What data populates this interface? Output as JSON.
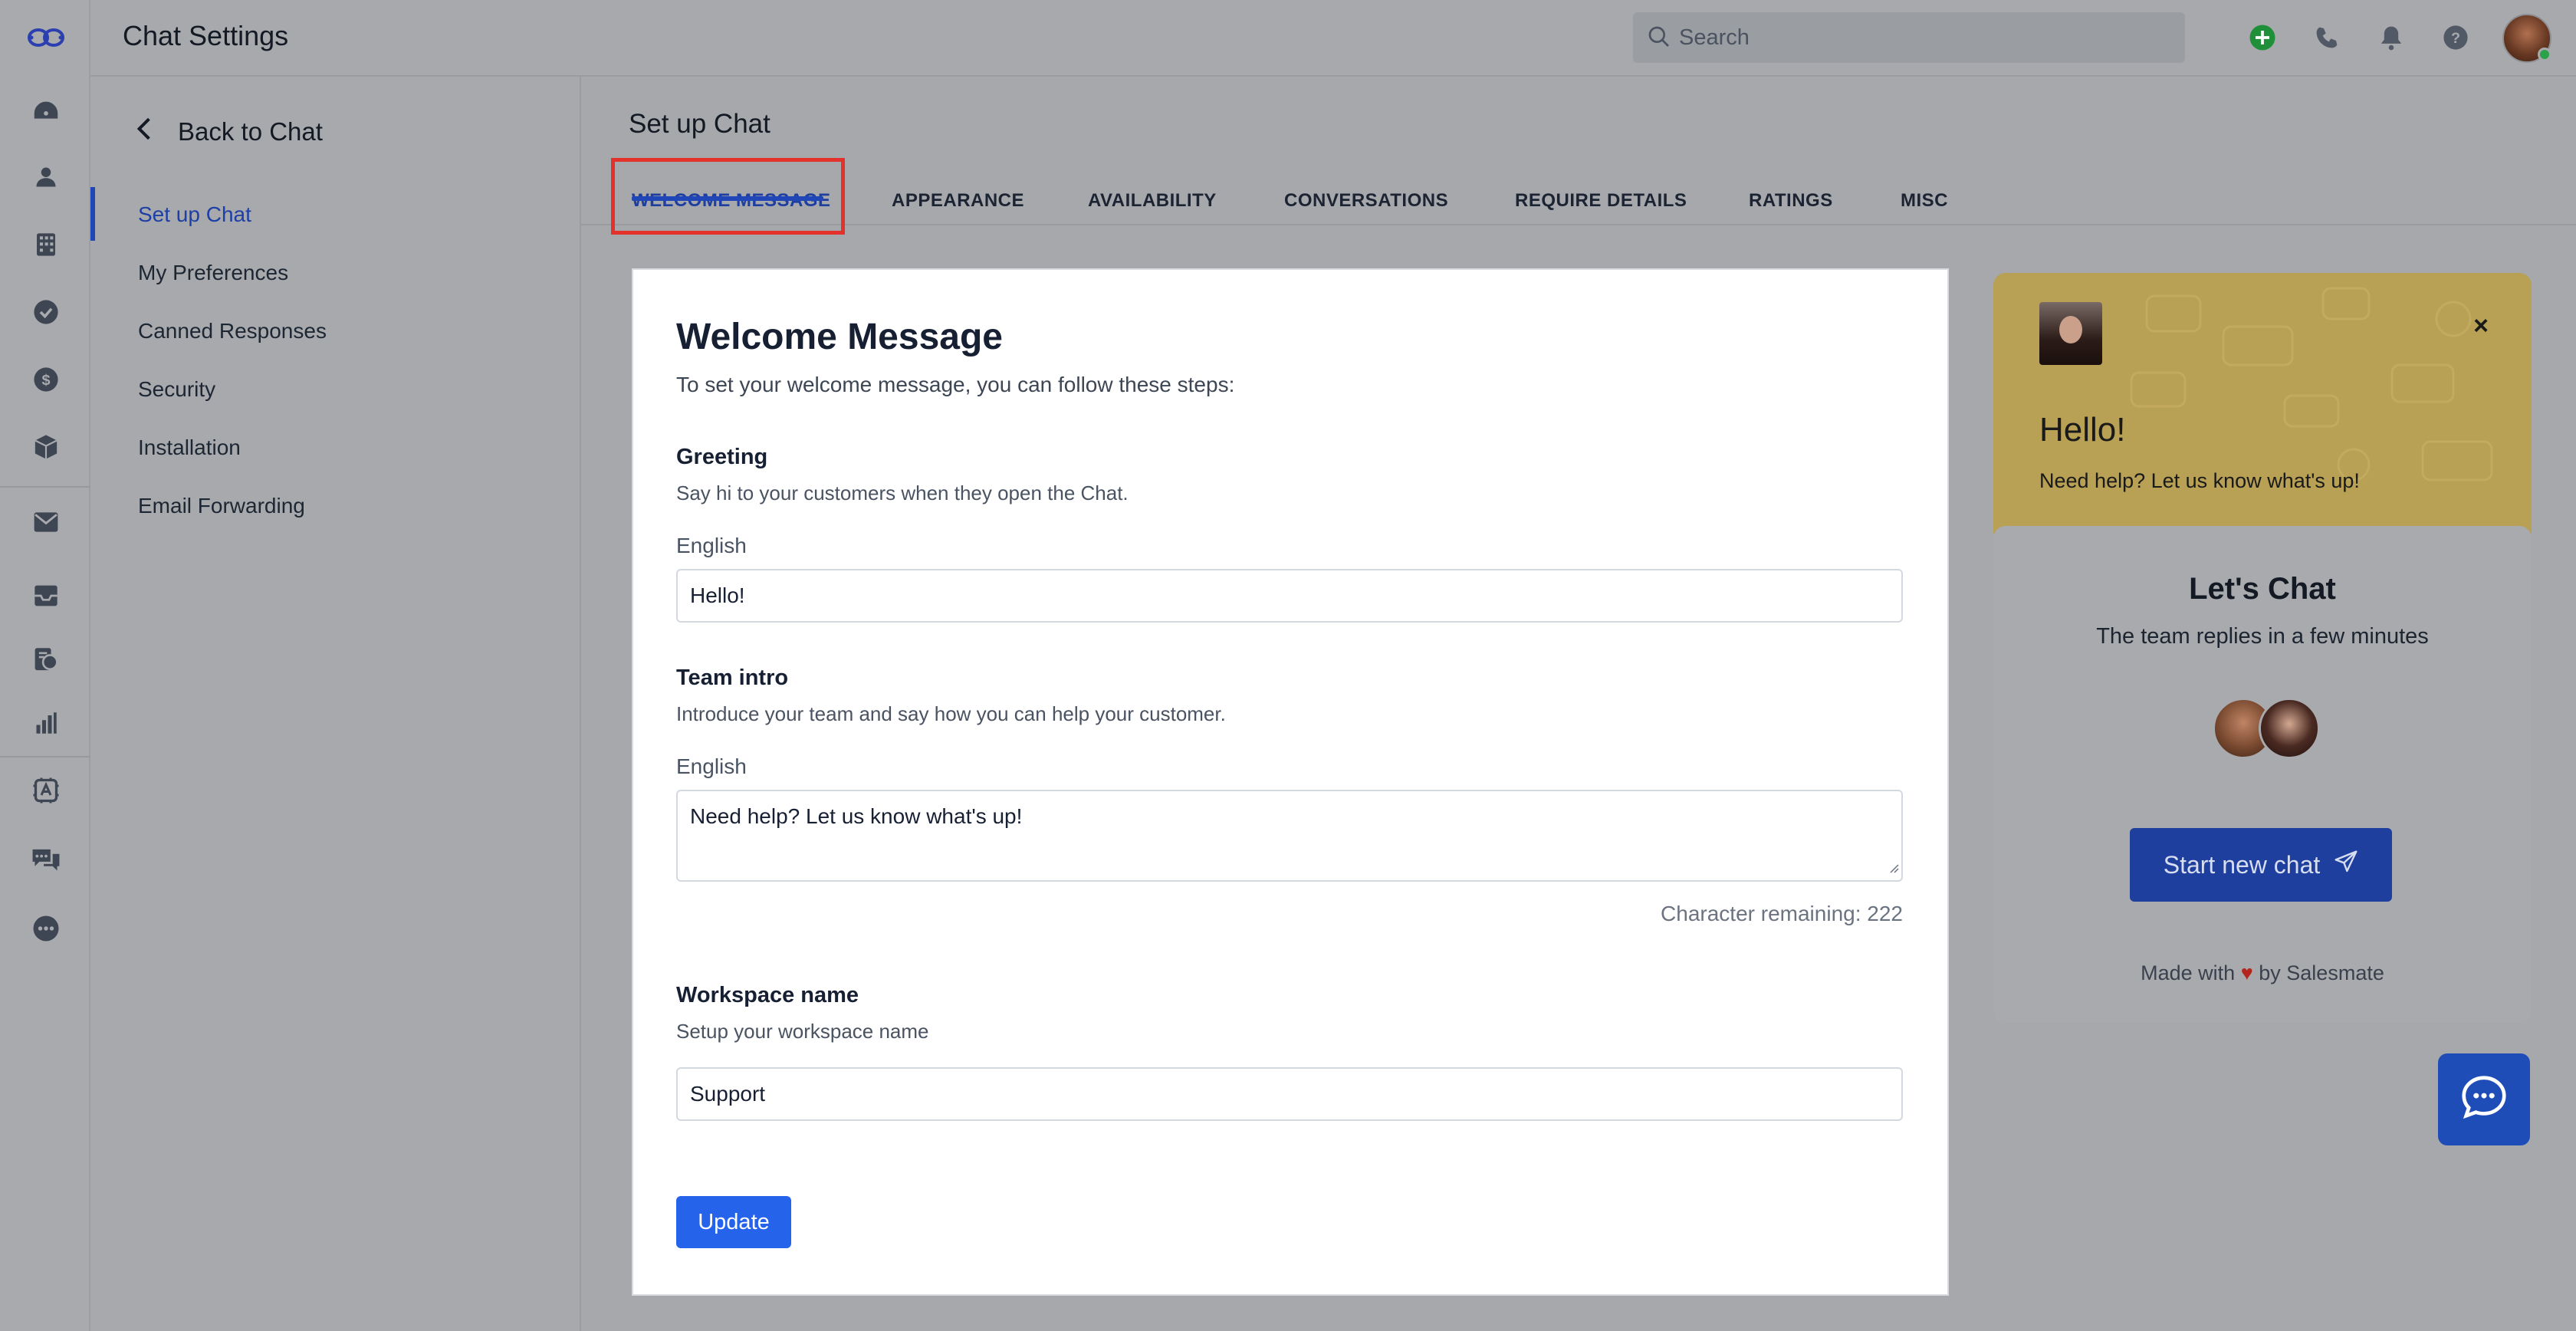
{
  "app": {
    "title": "Chat Settings"
  },
  "search": {
    "placeholder": "Search"
  },
  "rail": {
    "icons": [
      "logo-icon",
      "dashboard-icon",
      "contacts-icon",
      "companies-icon",
      "tasks-icon",
      "deals-icon",
      "products-icon",
      "email-icon",
      "inbox-icon",
      "chat-ticket-icon",
      "reports-icon",
      "automation-icon",
      "chat-icon",
      "more-icon"
    ]
  },
  "topbar": {
    "icons": [
      "add-icon",
      "phone-icon",
      "bell-icon",
      "help-icon"
    ]
  },
  "subnav": {
    "back_label": "Back to Chat",
    "items": [
      {
        "label": "Set up Chat",
        "active": true
      },
      {
        "label": "My Preferences"
      },
      {
        "label": "Canned Responses"
      },
      {
        "label": "Security"
      },
      {
        "label": "Installation"
      },
      {
        "label": "Email Forwarding"
      }
    ]
  },
  "main": {
    "page_title": "Set up Chat",
    "tabs": [
      {
        "label": "WELCOME MESSAGE",
        "active": true
      },
      {
        "label": "APPEARANCE"
      },
      {
        "label": "AVAILABILITY"
      },
      {
        "label": "CONVERSATIONS"
      },
      {
        "label": "REQUIRE DETAILS"
      },
      {
        "label": "RATINGS"
      },
      {
        "label": "MISC"
      }
    ]
  },
  "form": {
    "title": "Welcome Message",
    "subtitle": "To set your welcome message, you can follow these steps:",
    "greeting": {
      "title": "Greeting",
      "desc": "Say hi to your customers when they open the Chat.",
      "lang": "English",
      "value": "Hello!"
    },
    "team_intro": {
      "title": "Team intro",
      "desc": "Introduce your team and say how you can help your customer.",
      "lang": "English",
      "value": "Need help? Let us know what's up!",
      "char_remaining": "Character remaining: 222"
    },
    "workspace": {
      "title": "Workspace name",
      "desc": "Setup your workspace name",
      "value": "Support"
    },
    "update_label": "Update"
  },
  "preview": {
    "hello": "Hello!",
    "help": "Need help? Let us know what's up!",
    "close": "×",
    "lets_chat": "Let's Chat",
    "replies": "The team replies in a few minutes",
    "start_label": "Start new chat",
    "made_with": "Made with",
    "heart": "♥",
    "by": "by Salesmate",
    "colors": {
      "header": "#f5c842",
      "button": "#2349d1"
    }
  },
  "colors": {
    "accent": "#2146b8",
    "highlight_box": "#e3322b",
    "update_button": "#2563eb"
  }
}
